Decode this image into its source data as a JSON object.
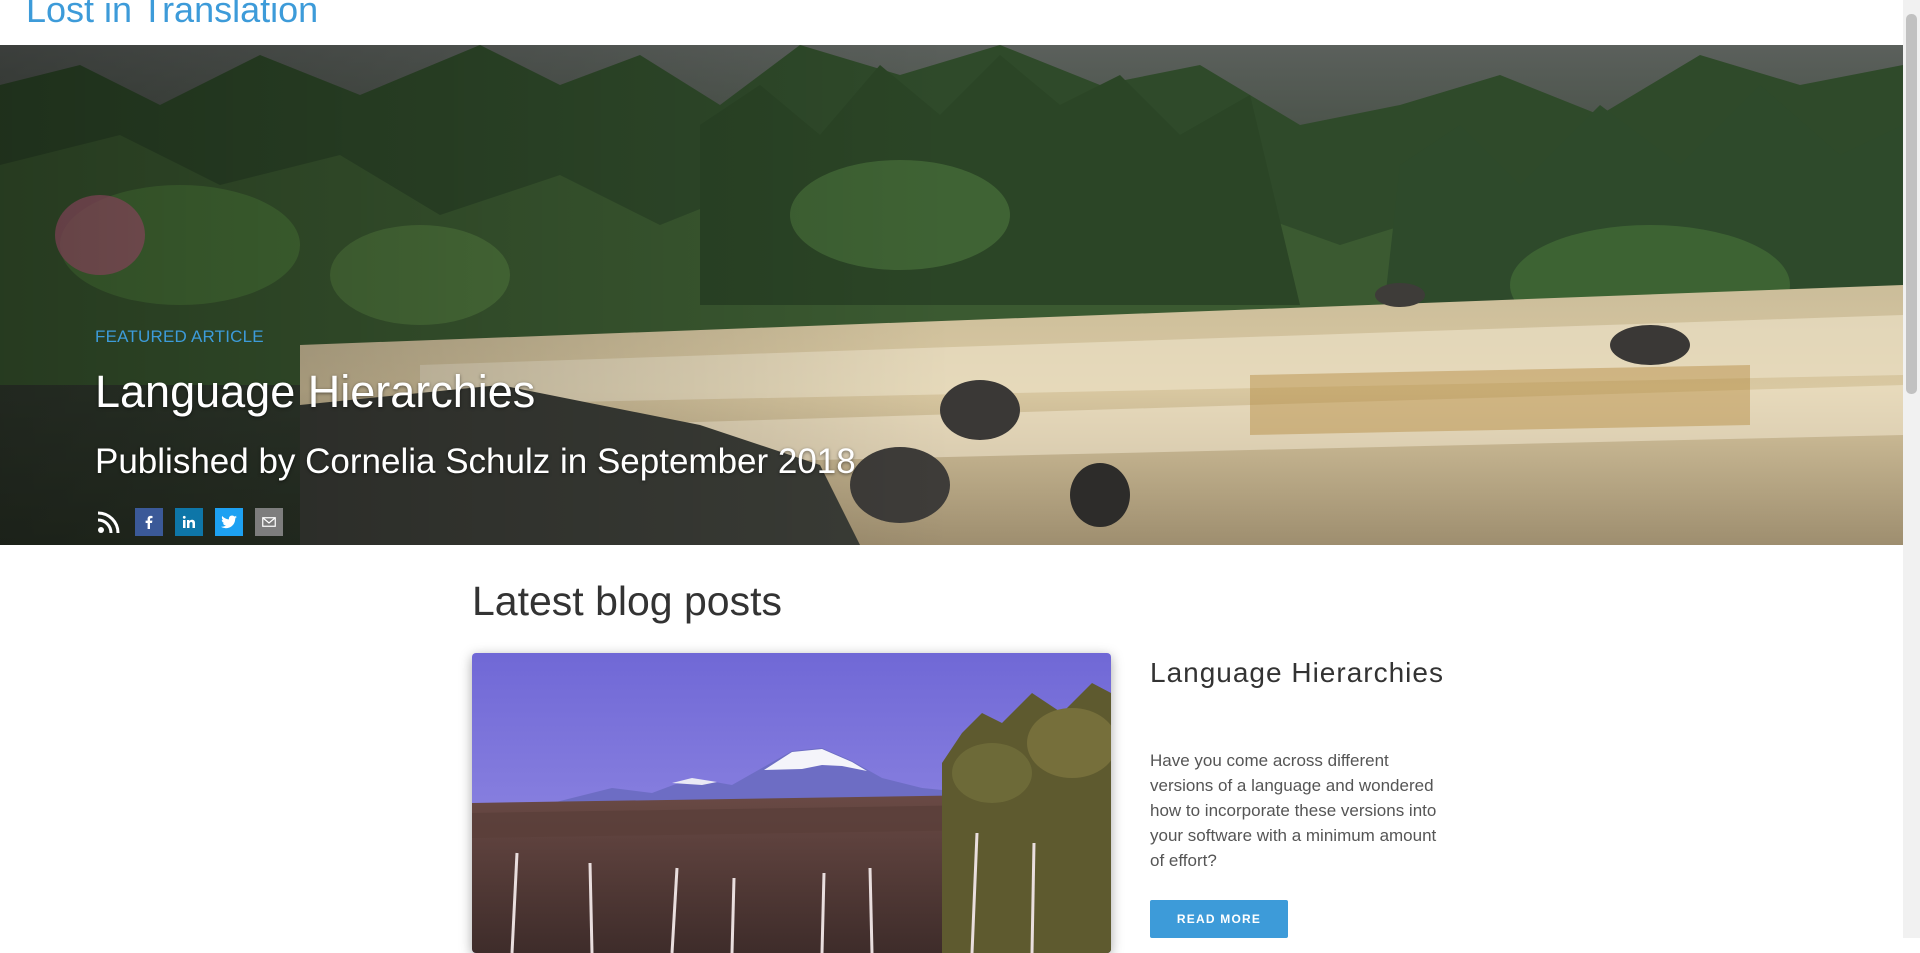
{
  "site": {
    "title": "Lost in Translation"
  },
  "hero": {
    "eyebrow": "FEATURED ARTICLE",
    "title": "Language Hierarchies",
    "subtitle": "Published by Cornelia Schulz in September 2018",
    "social": [
      {
        "icon": "rss-icon",
        "color": "#ffffff"
      },
      {
        "icon": "facebook-icon",
        "color": "#3b5998"
      },
      {
        "icon": "linkedin-icon",
        "color": "#0e76a8"
      },
      {
        "icon": "twitter-icon",
        "color": "#1da1f2"
      },
      {
        "icon": "email-icon",
        "color": "#7d7d7d"
      }
    ]
  },
  "main": {
    "section_title": "Latest blog posts",
    "posts": [
      {
        "title": "Language Hierarchies",
        "excerpt": "Have you come across different versions of a language and wondered how to incorporate these versions into your software with a minimum amount of effort?",
        "cta": "READ MORE"
      }
    ]
  },
  "colors": {
    "accent": "#3d9bd9",
    "text": "#333333"
  }
}
